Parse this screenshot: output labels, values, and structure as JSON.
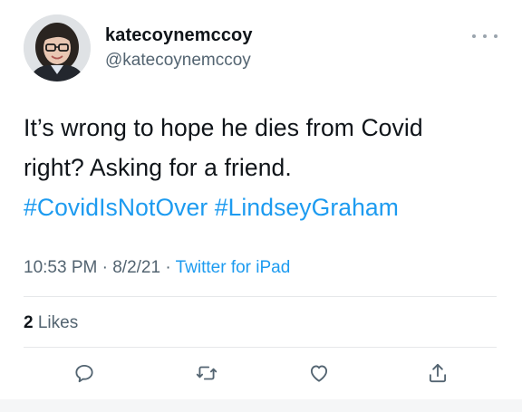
{
  "author": {
    "display_name": "katecoynemccoy",
    "handle": "@katecoynemccoy",
    "avatar_icon": "profile-photo"
  },
  "tweet": {
    "lines": [
      "It’s wrong to hope he dies from Covid",
      "right? Asking for a friend."
    ],
    "hashtags": [
      "#CovidIsNotOver",
      "#LindseyGraham"
    ]
  },
  "meta": {
    "time": "10:53 PM",
    "separator": " · ",
    "date": "8/2/21",
    "source": "Twitter for iPad"
  },
  "engagement": {
    "likes_count": "2",
    "likes_label": "Likes"
  },
  "actions": {
    "reply_icon": "reply-icon",
    "retweet_icon": "retweet-icon",
    "like_icon": "heart-icon",
    "share_icon": "share-icon"
  },
  "colors": {
    "text": "#0f1419",
    "secondary": "#536471",
    "link": "#1d9bf0",
    "divider": "#e6e8ea"
  }
}
